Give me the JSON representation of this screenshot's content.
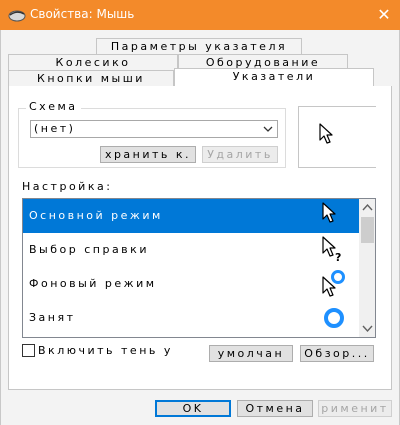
{
  "window": {
    "title": "Свойства: Мышь",
    "close": "✕"
  },
  "tabs": {
    "row1": [
      "Параметры указателя"
    ],
    "row2": [
      "Колесико",
      "Оборудование"
    ],
    "row3": [
      "Кнопки мыши",
      "Указатели"
    ]
  },
  "scheme": {
    "group_label": "Схема",
    "selected": "(нет)",
    "save_button": "хранить к.",
    "delete_button": "Удалить"
  },
  "customize": {
    "label": "Настройка:",
    "items": [
      {
        "label": "Основной режим",
        "icon": "arrow-cursor-icon",
        "selected": true
      },
      {
        "label": "Выбор справки",
        "icon": "help-select-cursor-icon",
        "selected": false
      },
      {
        "label": "Фоновый режим",
        "icon": "working-in-background-cursor-icon",
        "selected": false
      },
      {
        "label": "Занят",
        "icon": "busy-cursor-icon",
        "selected": false
      }
    ]
  },
  "shadow_checkbox": {
    "label": "Включить тень у",
    "checked": false
  },
  "default_button": "умолчан",
  "browse_button": "Обзор...",
  "footer": {
    "ok": "OK",
    "cancel": "Отмена",
    "apply": "рименит"
  },
  "colors": {
    "titlebar": "#f38a2a",
    "selection": "#0078d7",
    "busy_ring": "#1e90ff"
  }
}
